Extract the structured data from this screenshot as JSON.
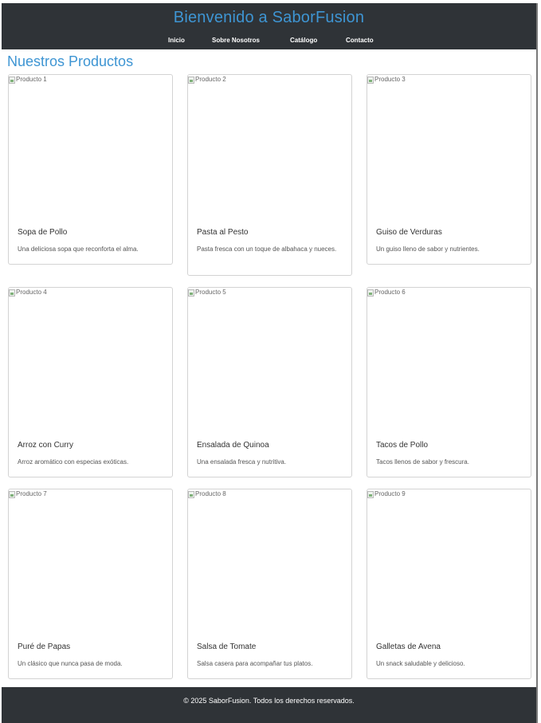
{
  "header": {
    "title": "Bienvenido a SaborFusion",
    "nav": [
      "Inicio",
      "Sobre Nosotros",
      "Catálogo",
      "Contacto"
    ]
  },
  "main": {
    "section_title": "Nuestros Productos",
    "products": [
      {
        "img_alt": "Producto 1",
        "name": "Sopa de Pollo",
        "description": "Una deliciosa sopa que reconforta el alma."
      },
      {
        "img_alt": "Producto 2",
        "name": "Pasta al Pesto",
        "description": "Pasta fresca con un toque de albahaca y nueces."
      },
      {
        "img_alt": "Producto 3",
        "name": "Guiso de Verduras",
        "description": "Un guiso lleno de sabor y nutrientes."
      },
      {
        "img_alt": "Producto 4",
        "name": "Arroz con Curry",
        "description": "Arroz aromático con especias exóticas."
      },
      {
        "img_alt": "Producto 5",
        "name": "Ensalada de Quinoa",
        "description": "Una ensalada fresca y nutritiva."
      },
      {
        "img_alt": "Producto 6",
        "name": "Tacos de Pollo",
        "description": "Tacos llenos de sabor y frescura."
      },
      {
        "img_alt": "Producto 7",
        "name": "Puré de Papas",
        "description": "Un clásico que nunca pasa de moda."
      },
      {
        "img_alt": "Producto 8",
        "name": "Salsa de Tomate",
        "description": "Salsa casera para acompañar tus platos."
      },
      {
        "img_alt": "Producto 9",
        "name": "Galletas de Avena",
        "description": "Un snack saludable y delicioso."
      }
    ]
  },
  "footer": {
    "text": "© 2025 SaborFusion. Todos los derechos reservados."
  },
  "colors": {
    "header_bg": "#2f3337",
    "accent": "#3e95d3",
    "card_border": "#d3d3d3"
  }
}
